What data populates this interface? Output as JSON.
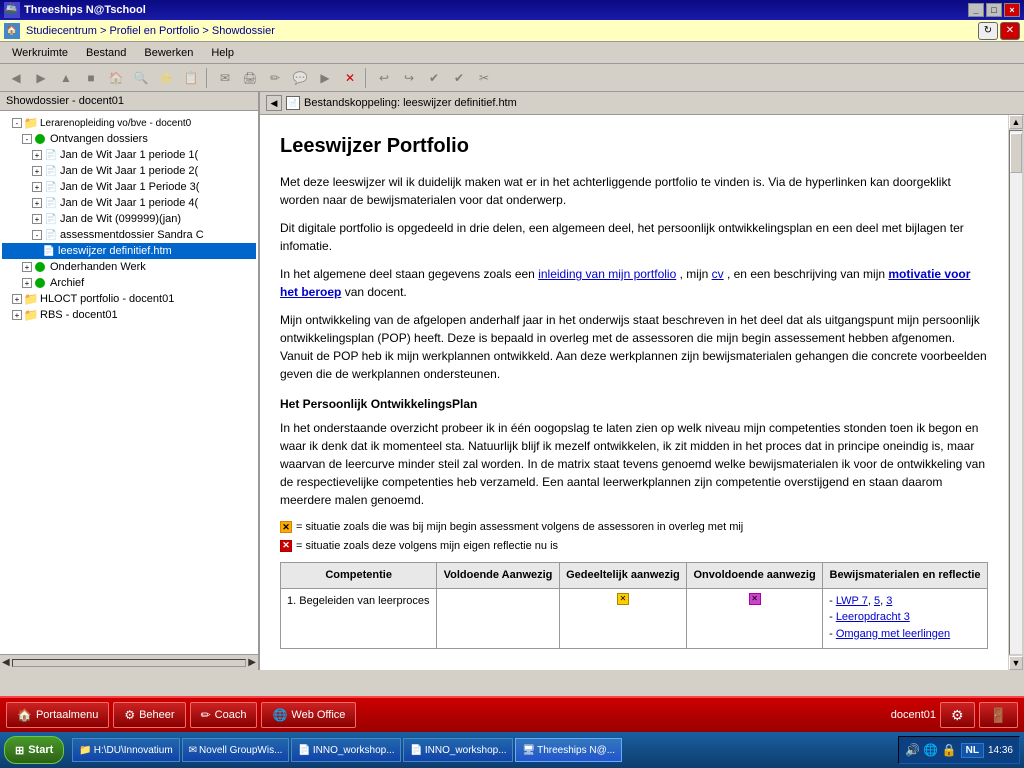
{
  "titlebar": {
    "title": "Threeships N@Tschool",
    "controls": [
      "_",
      "□",
      "×"
    ]
  },
  "addressbar": {
    "path": "Studiecentrum > Profiel en Portfolio > Showdossier"
  },
  "menubar": {
    "items": [
      "Werkruimte",
      "Bestand",
      "Bewerken",
      "Help"
    ]
  },
  "leftpanel": {
    "header": "Showdossier - docent01",
    "tree": [
      {
        "label": "Lerarenopleiding vo/bve - docent0",
        "level": 1,
        "type": "folder",
        "expanded": true
      },
      {
        "label": "Ontvangen dossiers",
        "level": 2,
        "type": "folder",
        "expanded": true
      },
      {
        "label": "Jan de Wit Jaar 1 periode 1(",
        "level": 3,
        "type": "doc"
      },
      {
        "label": "Jan de Wit Jaar 1 periode 2(",
        "level": 3,
        "type": "doc"
      },
      {
        "label": "Jan de Wit Jaar 1 Periode 3(",
        "level": 3,
        "type": "doc"
      },
      {
        "label": "Jan de Wit Jaar 1 periode 4(",
        "level": 3,
        "type": "doc"
      },
      {
        "label": "Jan de Wit (099999)(jan)",
        "level": 3,
        "type": "doc"
      },
      {
        "label": "assessmentdossier Sandra C",
        "level": 3,
        "type": "doc"
      },
      {
        "label": "leeswijzer definitief.htm",
        "level": 4,
        "type": "file",
        "selected": true
      },
      {
        "label": "Onderhanden Werk",
        "level": 2,
        "type": "folder"
      },
      {
        "label": "Archief",
        "level": 2,
        "type": "folder"
      },
      {
        "label": "HLOCT portfolio - docent01",
        "level": 1,
        "type": "folder"
      },
      {
        "label": "RBS - docent01",
        "level": 1,
        "type": "folder"
      }
    ]
  },
  "rightpanel": {
    "header": "Bestandskoppeling: leeswijzer definitief.htm",
    "content": {
      "title": "Leeswijzer Portfolio",
      "para1": "Met deze leeswijzer wil ik duidelijk maken wat er in het achterliggende portfolio te vinden is. Via de hyperlinken kan doorgeklikt worden naar de bewijsmaterialen voor dat onderwerp.",
      "para2": "Dit digitale portfolio is opgedeeld in drie delen, een algemeen deel, het persoonlijk ontwikkelingsplan en een deel met bijlagen ter infomatie.",
      "para3_pre": "In het algemene deel staan gegevens zoals een ",
      "link1": "inleiding van mijn portfolio",
      "para3_mid": ", mijn ",
      "link2": "cv",
      "para3_post": ", en een beschrijving van mijn ",
      "link3": "motivatie voor het beroep",
      "para3_end": " van docent.",
      "para4": "Mijn ontwikkeling van de afgelopen anderhalf jaar in het onderwijs staat beschreven in het deel dat als uitgangspunt mijn persoonlijk ontwikkelingsplan (POP) heeft. Deze is bepaald in overleg met de assessoren die mijn begin assessement hebben afgenomen. Vanuit de POP heb ik mijn werkplannen ontwikkeld. Aan deze werkplannen zijn bewijsmaterialen gehangen die concrete voorbeelden geven die de werkplannen ondersteunen.",
      "section_title": "Het Persoonlijk OntwikkelingsPlan",
      "para5": "In het onderstaande overzicht probeer ik in één oogopslag te laten zien op welk niveau mijn competenties stonden toen ik begon en waar ik denk dat ik momenteel sta. Natuurlijk blijf ik mezelf ontwikkelen, ik zit midden in het proces dat in principe oneindig is, maar waarvan de leercurve minder steil zal worden. In de matrix staat tevens genoemd welke bewijsmaterialen ik voor de ontwikkeling van de respectievelijke competenties heb verzameld. Een aantal leerwerkplannen zijn competentie overstijgend en staan daarom meerdere malen genoemd.",
      "legend1": "= situatie zoals die was bij mijn begin assessment volgens de assessoren in overleg met mij",
      "legend2": "= situatie zoals deze volgens mijn eigen reflectie nu is",
      "table": {
        "headers": [
          "Competentie",
          "Voldoende Aanwezig",
          "Gedeeltelijk aanwezig",
          "Onvoldoende aanwezig",
          "Bewijsmaterialen en reflectie"
        ],
        "rows": [
          {
            "competentie": "1. Begeleiden van leerproces",
            "voldoende": "",
            "gedeeltelijk": "X_yellow",
            "onvoldoende": "X_pink",
            "bewijs_links": [
              "LWP 7",
              "5",
              "3",
              "Leeropdracht 3",
              "Omgang met leerlingen"
            ]
          }
        ]
      }
    }
  },
  "appbar": {
    "buttons": [
      {
        "label": "Portaalmenu",
        "icon": "🏠"
      },
      {
        "label": "Beheer",
        "icon": "⚙"
      },
      {
        "label": "Coach",
        "icon": "✏"
      },
      {
        "label": "Web Office",
        "icon": "🌐"
      }
    ],
    "user": "docent01"
  },
  "taskbar": {
    "start_label": "Start",
    "tasks": [
      {
        "label": "H:\\DU\\Innovatium",
        "icon": "📁"
      },
      {
        "label": "Novell GroupWis...",
        "icon": "✉"
      },
      {
        "label": "INNO_workshop...",
        "icon": "📄"
      },
      {
        "label": "INNO_workshop...",
        "icon": "📄"
      },
      {
        "label": "Threeships N@...",
        "icon": "🖥",
        "active": true
      }
    ],
    "tray": {
      "lang": "NL",
      "time": "14:36"
    }
  }
}
